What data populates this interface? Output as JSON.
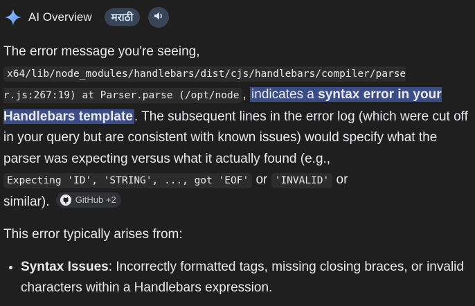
{
  "header": {
    "title": "AI Overview",
    "language_chip": "मराठी",
    "icons": {
      "brand": "sparkle-icon",
      "listen": "speaker-icon"
    },
    "accent": "#8ab4f8"
  },
  "answer": {
    "p1_intro": "The error message you're seeing,",
    "p1_code_path": "x64/lib/node_modules/handlebars/dist/cjs/handlebars/compiler/parse",
    "p1_code_path_cont": "r.js:267:19) at Parser.parse (/opt/node",
    "p1_comma": ",",
    "p1_hl_a": "indicates a ",
    "p1_hl_b": "syntax error in your Handlebars template",
    "p1_rest": ". The subsequent lines in the error log (which were cut off in your query but are consistent with known issues) would specify what the parser was expecting versus what it actually found (e.g.,",
    "p1_code_expecting": "Expecting 'ID', 'STRING', ..., got 'EOF'",
    "p1_or1": "or",
    "p1_code_invalid": "'INVALID'",
    "p1_or2": "or",
    "p1_end": "similar).",
    "source_chip": "GitHub +2",
    "p2": "This error typically arises from:",
    "bullets": [
      {
        "title": "Syntax Issues",
        "text": ": Incorrectly formatted tags, missing closing braces, or invalid characters within a Handlebars expression."
      }
    ],
    "highlight_color": "#3b4d86"
  }
}
